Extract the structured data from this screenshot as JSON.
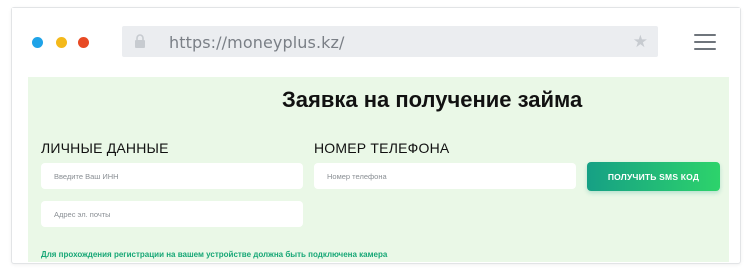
{
  "browser": {
    "url": "https://moneyplus.kz/",
    "window_dots": [
      {
        "color": "#1fa3e8"
      },
      {
        "color": "#f4b91a"
      },
      {
        "color": "#e84a24"
      }
    ],
    "icons": {
      "lock": "lock-icon",
      "star": "star-icon",
      "menu": "hamburger-menu-icon"
    }
  },
  "page": {
    "title": "Заявка на получение займа",
    "personal_section": {
      "label": "ЛИЧНЫЕ ДАННЫЕ",
      "inn_placeholder": "Введите Ваш ИНН",
      "email_placeholder": "Адрес эл. почты"
    },
    "phone_section": {
      "label": "НОМЕР ТЕЛЕФОНА",
      "phone_placeholder": "Номер телефона"
    },
    "sms_button_label": "ПОЛУЧИТЬ SMS КОД",
    "notice": "Для прохождения регистрации на вашем устройстве должна быть подключена камера",
    "colors": {
      "background": "#eaf8e7",
      "accent_start": "#16a085",
      "accent_end": "#2dd36b",
      "notice": "#17a776"
    }
  }
}
